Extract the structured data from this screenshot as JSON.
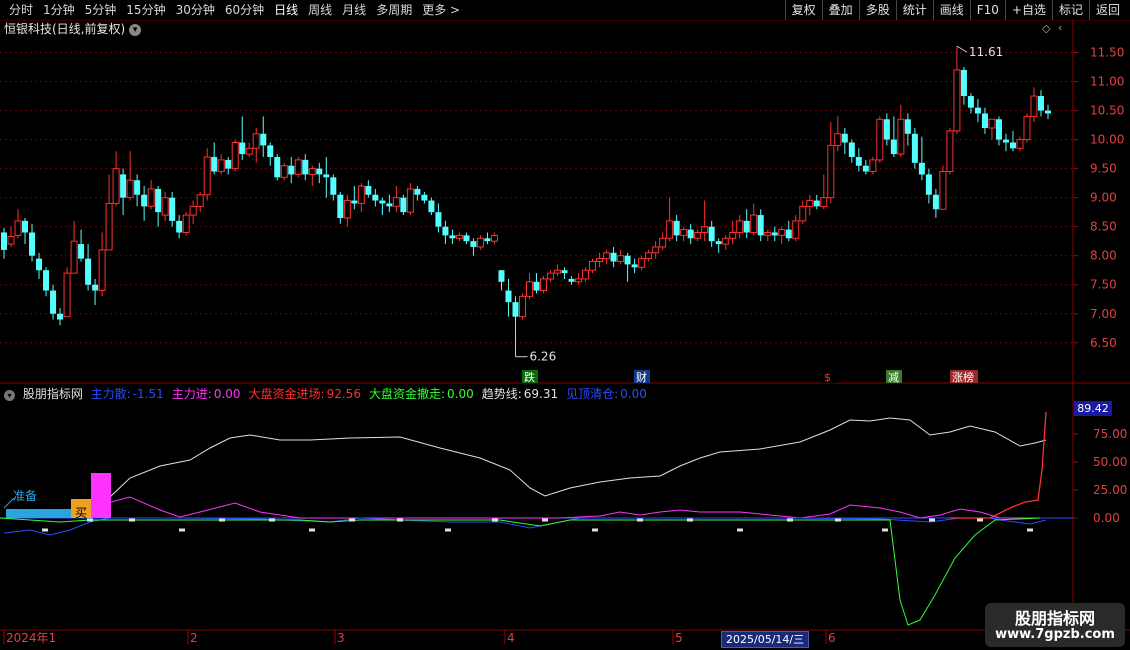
{
  "toolbar": {
    "periods": [
      "分时",
      "1分钟",
      "5分钟",
      "15分钟",
      "30分钟",
      "60分钟",
      "日线",
      "周线",
      "月线",
      "多周期",
      "更多 >"
    ],
    "active_period": "日线",
    "actions": [
      "复权",
      "叠加",
      "多股",
      "统计",
      "画线",
      "F10",
      "+自选",
      "标记",
      "返回"
    ]
  },
  "stock": {
    "title": "恒银科技(日线,前复权)"
  },
  "price_axis": {
    "ticks": [
      "11.50",
      "11.00",
      "10.50",
      "10.00",
      "9.50",
      "9.00",
      "8.50",
      "8.00",
      "7.50",
      "7.00",
      "6.50"
    ],
    "min": 6.1,
    "max": 11.75
  },
  "annotations": {
    "high": "11.61",
    "low": "6.26"
  },
  "events": [
    {
      "label": "跌",
      "color": "#ffffff",
      "bg": "#0a6a0a"
    },
    {
      "label": "财",
      "color": "#ffffff",
      "bg": "#103a8a"
    },
    {
      "label": "$",
      "color": "#ff3030",
      "bg": "#000000"
    },
    {
      "label": "减",
      "color": "#ffffff",
      "bg": "#3a7a2a"
    },
    {
      "label": "涨榜",
      "color": "#ffffff",
      "bg": "#9a2a2a"
    }
  ],
  "indicator": {
    "name": "股朋指标网",
    "items": [
      {
        "label": "主力散:",
        "value": "-1.51",
        "color": "#2a4cff"
      },
      {
        "label": "主力进:",
        "value": "0.00",
        "color": "#ff33ff"
      },
      {
        "label": "大盘资金进场:",
        "value": "92.56",
        "color": "#ff3030"
      },
      {
        "label": "大盘资金撤走:",
        "value": "0.00",
        "color": "#33ff33"
      },
      {
        "label": "趋势线:",
        "value": "69.31",
        "color": "#e0e0e0"
      },
      {
        "label": "见顶清仓:",
        "value": "0.00",
        "color": "#2a4cff"
      }
    ],
    "axis_ticks": [
      "75.00",
      "50.00",
      "25.00",
      "0.00"
    ],
    "current_value": "89.42",
    "marker_prepare": "准备",
    "marker_buy": "买"
  },
  "time_axis": {
    "labels": [
      "2024年1",
      "2",
      "3",
      "4",
      "5",
      "6"
    ],
    "selected_date": "2025/05/14/三"
  },
  "watermark": {
    "title": "股朋指标网",
    "url": "www.7gpzb.com"
  },
  "colors": {
    "up": "#ff3030",
    "down": "#54ffff",
    "grid": "#6a0000"
  },
  "chart_data": {
    "type": "candlestick",
    "candles": [
      [
        8.4,
        8.48,
        8.1,
        7.95
      ],
      [
        8.2,
        8.5,
        8.33,
        8.15
      ],
      [
        8.35,
        8.8,
        8.6,
        8.3
      ],
      [
        8.6,
        8.65,
        8.4,
        8.2
      ],
      [
        8.4,
        8.55,
        8.0,
        7.9
      ],
      [
        7.95,
        8.05,
        7.75,
        7.6
      ],
      [
        7.75,
        7.8,
        7.4,
        7.3
      ],
      [
        7.4,
        7.5,
        7.0,
        6.9
      ],
      [
        7.0,
        7.1,
        6.9,
        6.8
      ],
      [
        6.95,
        7.8,
        7.7,
        6.95
      ],
      [
        7.7,
        8.6,
        8.25,
        7.7
      ],
      [
        8.2,
        8.45,
        7.95,
        7.9
      ],
      [
        7.95,
        8.2,
        7.5,
        7.4
      ],
      [
        7.5,
        7.6,
        7.4,
        7.15
      ],
      [
        7.4,
        8.4,
        8.1,
        7.3
      ],
      [
        8.1,
        9.4,
        8.9,
        8.1
      ],
      [
        8.9,
        9.8,
        9.5,
        8.85
      ],
      [
        9.4,
        9.5,
        9.0,
        8.7
      ],
      [
        9.0,
        9.8,
        9.3,
        8.95
      ],
      [
        9.3,
        9.4,
        9.05,
        8.85
      ],
      [
        9.05,
        9.2,
        8.85,
        8.6
      ],
      [
        8.85,
        9.3,
        9.15,
        8.8
      ],
      [
        9.15,
        9.2,
        8.75,
        8.5
      ],
      [
        8.7,
        9.1,
        9.0,
        8.6
      ],
      [
        9.0,
        9.1,
        8.6,
        8.5
      ],
      [
        8.6,
        8.7,
        8.4,
        8.3
      ],
      [
        8.4,
        8.75,
        8.7,
        8.35
      ],
      [
        8.7,
        8.95,
        8.85,
        8.55
      ],
      [
        8.85,
        9.1,
        9.05,
        8.75
      ],
      [
        9.05,
        9.85,
        9.7,
        8.95
      ],
      [
        9.7,
        9.95,
        9.45,
        9.4
      ],
      [
        9.45,
        9.75,
        9.65,
        9.4
      ],
      [
        9.65,
        9.7,
        9.5,
        9.4
      ],
      [
        9.5,
        10.0,
        9.95,
        9.45
      ],
      [
        9.95,
        10.4,
        9.75,
        9.65
      ],
      [
        9.75,
        9.95,
        9.85,
        9.7
      ],
      [
        9.85,
        10.2,
        10.1,
        9.6
      ],
      [
        10.1,
        10.4,
        9.9,
        9.7
      ],
      [
        9.9,
        9.95,
        9.7,
        9.55
      ],
      [
        9.7,
        9.75,
        9.35,
        9.3
      ],
      [
        9.35,
        9.6,
        9.55,
        9.3
      ],
      [
        9.55,
        9.7,
        9.4,
        9.25
      ],
      [
        9.4,
        9.7,
        9.65,
        9.35
      ],
      [
        9.65,
        9.75,
        9.4,
        9.3
      ],
      [
        9.4,
        9.55,
        9.5,
        9.2
      ],
      [
        9.5,
        9.6,
        9.4,
        9.25
      ],
      [
        9.4,
        9.7,
        9.35,
        9.0
      ],
      [
        9.35,
        9.4,
        9.05,
        8.95
      ],
      [
        9.05,
        9.1,
        8.65,
        8.55
      ],
      [
        8.65,
        9.05,
        8.95,
        8.5
      ],
      [
        8.95,
        9.2,
        8.9,
        8.8
      ],
      [
        8.9,
        9.25,
        9.2,
        8.75
      ],
      [
        9.2,
        9.3,
        9.05,
        9.0
      ],
      [
        9.05,
        9.15,
        8.95,
        8.85
      ],
      [
        8.95,
        9.0,
        8.9,
        8.7
      ],
      [
        8.9,
        9.05,
        8.85,
        8.75
      ],
      [
        8.85,
        9.2,
        9.0,
        8.75
      ],
      [
        9.0,
        9.05,
        8.75,
        8.7
      ],
      [
        8.75,
        9.25,
        9.15,
        8.7
      ],
      [
        9.15,
        9.2,
        9.05,
        8.95
      ],
      [
        9.05,
        9.1,
        8.95,
        8.9
      ],
      [
        8.95,
        9.0,
        8.75,
        8.7
      ],
      [
        8.75,
        8.9,
        8.5,
        8.4
      ],
      [
        8.5,
        8.6,
        8.35,
        8.2
      ],
      [
        8.35,
        8.45,
        8.3,
        8.2
      ],
      [
        8.3,
        8.4,
        8.35,
        8.25
      ],
      [
        8.35,
        8.4,
        8.25,
        8.2
      ],
      [
        8.25,
        8.3,
        8.15,
        8.0
      ],
      [
        8.15,
        8.35,
        8.3,
        8.1
      ],
      [
        8.3,
        8.4,
        8.25,
        8.2
      ],
      [
        8.25,
        8.4,
        8.35,
        8.2
      ],
      [
        7.75,
        7.65,
        7.55,
        7.4
      ],
      [
        7.4,
        7.6,
        7.2,
        6.95
      ],
      [
        7.2,
        7.3,
        6.95,
        6.26
      ],
      [
        6.95,
        7.35,
        7.3,
        6.9
      ],
      [
        7.3,
        7.7,
        7.55,
        7.25
      ],
      [
        7.55,
        7.7,
        7.4,
        7.35
      ],
      [
        7.4,
        7.65,
        7.6,
        7.35
      ],
      [
        7.6,
        7.75,
        7.7,
        7.55
      ],
      [
        7.7,
        7.85,
        7.75,
        7.65
      ],
      [
        7.75,
        7.8,
        7.7,
        7.6
      ],
      [
        7.6,
        7.65,
        7.55,
        7.5
      ],
      [
        7.55,
        7.7,
        7.6,
        7.5
      ],
      [
        7.6,
        7.8,
        7.75,
        7.55
      ],
      [
        7.75,
        7.95,
        7.9,
        7.7
      ],
      [
        7.9,
        8.05,
        7.95,
        7.8
      ],
      [
        7.95,
        8.1,
        8.05,
        7.85
      ],
      [
        8.05,
        8.15,
        7.9,
        7.8
      ],
      [
        7.9,
        8.1,
        8.0,
        7.85
      ],
      [
        8.0,
        8.05,
        7.85,
        7.55
      ],
      [
        7.85,
        7.95,
        7.8,
        7.7
      ],
      [
        7.8,
        8.0,
        7.95,
        7.75
      ],
      [
        7.95,
        8.1,
        8.05,
        7.9
      ],
      [
        8.05,
        8.25,
        8.15,
        7.95
      ],
      [
        8.15,
        8.4,
        8.3,
        8.1
      ],
      [
        8.3,
        9.0,
        8.6,
        8.25
      ],
      [
        8.6,
        8.7,
        8.35,
        8.25
      ],
      [
        8.35,
        8.5,
        8.45,
        8.25
      ],
      [
        8.45,
        8.55,
        8.3,
        8.2
      ],
      [
        8.3,
        8.45,
        8.4,
        8.25
      ],
      [
        8.4,
        8.95,
        8.5,
        8.25
      ],
      [
        8.5,
        8.6,
        8.25,
        8.15
      ],
      [
        8.25,
        8.3,
        8.2,
        8.05
      ],
      [
        8.2,
        8.35,
        8.3,
        8.1
      ],
      [
        8.3,
        8.6,
        8.4,
        8.2
      ],
      [
        8.4,
        8.7,
        8.6,
        8.3
      ],
      [
        8.6,
        8.8,
        8.4,
        8.3
      ],
      [
        8.4,
        8.9,
        8.7,
        8.35
      ],
      [
        8.7,
        8.8,
        8.35,
        8.25
      ],
      [
        8.35,
        8.45,
        8.4,
        8.25
      ],
      [
        8.4,
        8.5,
        8.35,
        8.25
      ],
      [
        8.35,
        8.5,
        8.45,
        8.2
      ],
      [
        8.45,
        8.6,
        8.3,
        8.25
      ],
      [
        8.3,
        8.7,
        8.6,
        8.25
      ],
      [
        8.6,
        8.95,
        8.85,
        8.55
      ],
      [
        8.85,
        9.05,
        8.95,
        8.7
      ],
      [
        8.95,
        9.05,
        8.85,
        8.8
      ],
      [
        8.85,
        9.4,
        9.0,
        8.8
      ],
      [
        9.0,
        10.3,
        9.9,
        8.9
      ],
      [
        9.9,
        10.4,
        10.1,
        9.8
      ],
      [
        10.1,
        10.2,
        9.95,
        9.75
      ],
      [
        9.95,
        10.0,
        9.7,
        9.6
      ],
      [
        9.7,
        9.85,
        9.55,
        9.45
      ],
      [
        9.55,
        9.65,
        9.45,
        9.4
      ],
      [
        9.45,
        9.7,
        9.65,
        9.4
      ],
      [
        9.65,
        10.4,
        10.35,
        9.6
      ],
      [
        10.35,
        10.45,
        10.0,
        9.9
      ],
      [
        10.0,
        10.4,
        9.75,
        9.7
      ],
      [
        9.75,
        10.6,
        10.35,
        9.7
      ],
      [
        10.35,
        10.45,
        10.1,
        9.9
      ],
      [
        10.1,
        10.2,
        9.6,
        9.5
      ],
      [
        9.6,
        10.05,
        9.4,
        9.3
      ],
      [
        9.4,
        9.5,
        9.05,
        8.9
      ],
      [
        9.05,
        9.15,
        8.8,
        8.65
      ],
      [
        8.8,
        9.55,
        9.45,
        8.8
      ],
      [
        9.45,
        10.2,
        10.15,
        9.4
      ],
      [
        10.15,
        11.61,
        11.2,
        10.1
      ],
      [
        11.2,
        11.25,
        10.75,
        10.6
      ],
      [
        10.75,
        10.8,
        10.55,
        10.45
      ],
      [
        10.55,
        10.7,
        10.45,
        10.3
      ],
      [
        10.45,
        10.55,
        10.2,
        10.1
      ],
      [
        10.2,
        10.35,
        10.35,
        10.0
      ],
      [
        10.35,
        10.4,
        10.0,
        9.9
      ],
      [
        10.0,
        10.1,
        9.95,
        9.8
      ],
      [
        9.95,
        10.15,
        9.85,
        9.8
      ],
      [
        9.85,
        10.05,
        10.0,
        9.8
      ],
      [
        10.0,
        10.45,
        10.4,
        9.95
      ],
      [
        10.4,
        10.9,
        10.75,
        10.3
      ],
      [
        10.75,
        10.85,
        10.5,
        10.4
      ],
      [
        10.5,
        10.6,
        10.45,
        10.35
      ]
    ]
  }
}
